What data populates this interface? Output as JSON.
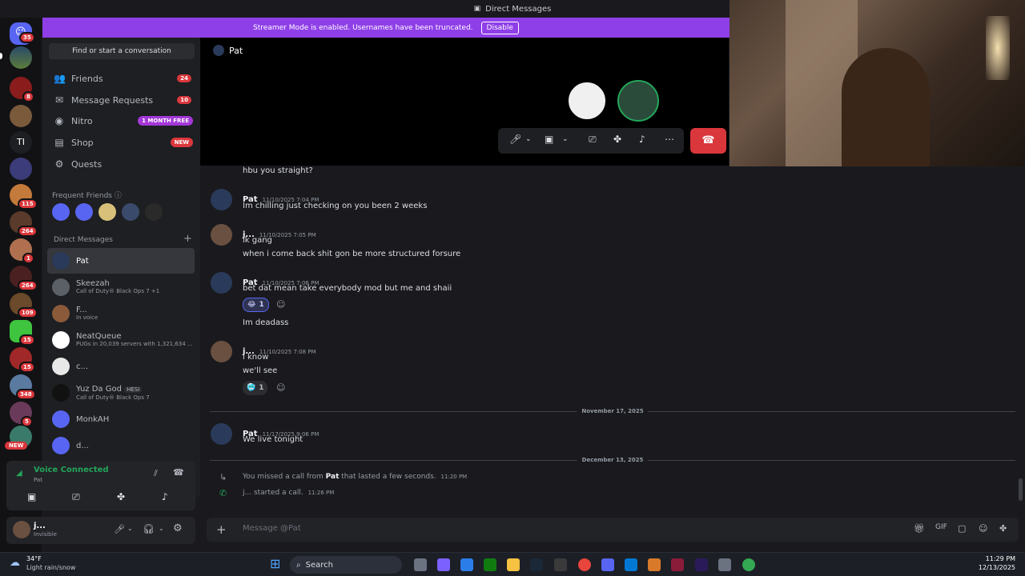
{
  "window": {
    "title": "Direct Messages"
  },
  "banner": {
    "text": "Streamer Mode is enabled. Usernames have been truncated.",
    "button": "Disable"
  },
  "rail": {
    "badges": [
      "35",
      "8",
      "115",
      "264",
      "1",
      "264",
      "109",
      "15",
      "15",
      "348",
      "5"
    ],
    "new_label": "NEW",
    "text_server": "TI"
  },
  "sidebar": {
    "find": "Find or start a conversation",
    "nav": [
      {
        "label": "Friends",
        "icon": "friends-icon",
        "badge": "24"
      },
      {
        "label": "Message Requests",
        "icon": "envelope-icon",
        "badge": "10"
      },
      {
        "label": "Nitro",
        "icon": "nitro-icon",
        "pill": "1 MONTH FREE"
      },
      {
        "label": "Shop",
        "icon": "shop-icon",
        "pill": "NEW"
      },
      {
        "label": "Quests",
        "icon": "quests-icon"
      }
    ],
    "frequent_friends": "Frequent Friends",
    "direct_messages": "Direct Messages",
    "add": "+",
    "dms": [
      {
        "name": "Pat",
        "sub": ""
      },
      {
        "name": "Skeezah",
        "sub": "Call of Duty® Black Ops 7 +1"
      },
      {
        "name": "F...",
        "sub": "In voice"
      },
      {
        "name": "NeatQueue",
        "sub": "PUGs in 20,039 servers with 1,321,634 ..."
      },
      {
        "name": "c...",
        "sub": ""
      },
      {
        "name": "Yuz Da God",
        "sub": "Call of Duty® Black Ops 7",
        "tag": "HESI"
      },
      {
        "name": "MonkAH",
        "sub": ""
      },
      {
        "name": "d...",
        "sub": ""
      }
    ]
  },
  "voice": {
    "status": "Voice Connected",
    "channel": "Pat"
  },
  "user": {
    "name": "j...",
    "status": "Invisible"
  },
  "chat": {
    "header": "Pat",
    "messages": [
      {
        "text": "hbu you straight?"
      },
      {
        "author": "Pat",
        "time": "11/10/2025 7:04 PM",
        "lines": [
          "Im chilling just checking on you been 2 weeks"
        ]
      },
      {
        "author": "j...",
        "time": "11/10/2025 7:05 PM",
        "lines": [
          "ik gang",
          "when i come back shit gon be more structured forsure"
        ]
      },
      {
        "author": "Pat",
        "time": "11/10/2025 7:06 PM",
        "lines": [
          "bet dat mean take everybody mod but me and shaii"
        ],
        "reaction": {
          "emoji": "😂",
          "count": "1"
        }
      },
      {
        "text": "Im deadass"
      },
      {
        "author": "j...",
        "time": "11/10/2025 7:08 PM",
        "lines": [
          "i know",
          "we'll see"
        ],
        "reaction": {
          "emoji": "🥶",
          "count": "1"
        }
      },
      {
        "author": "Pat",
        "time": "11/17/2025 9:06 PM",
        "lines": [
          "We live tonight"
        ]
      }
    ],
    "date1": "November 17, 2025",
    "date2": "December 13, 2025",
    "call1": {
      "pre": "You missed a call from ",
      "name": "Pat",
      "post": " that lasted a few seconds.",
      "time": "11:20 PM"
    },
    "call2": {
      "pre": "j... started a call.",
      "time": "11:26 PM"
    },
    "input_placeholder": "Message @Pat"
  },
  "taskbar": {
    "temp": "34°F",
    "weather": "Light rain/snow",
    "search": "Search",
    "time": "11:29 PM",
    "date": "12/13/2025"
  },
  "colors": {
    "accent": "#5865f2",
    "banner": "#8f3fe8",
    "danger": "#da373c",
    "green": "#23a55a"
  }
}
